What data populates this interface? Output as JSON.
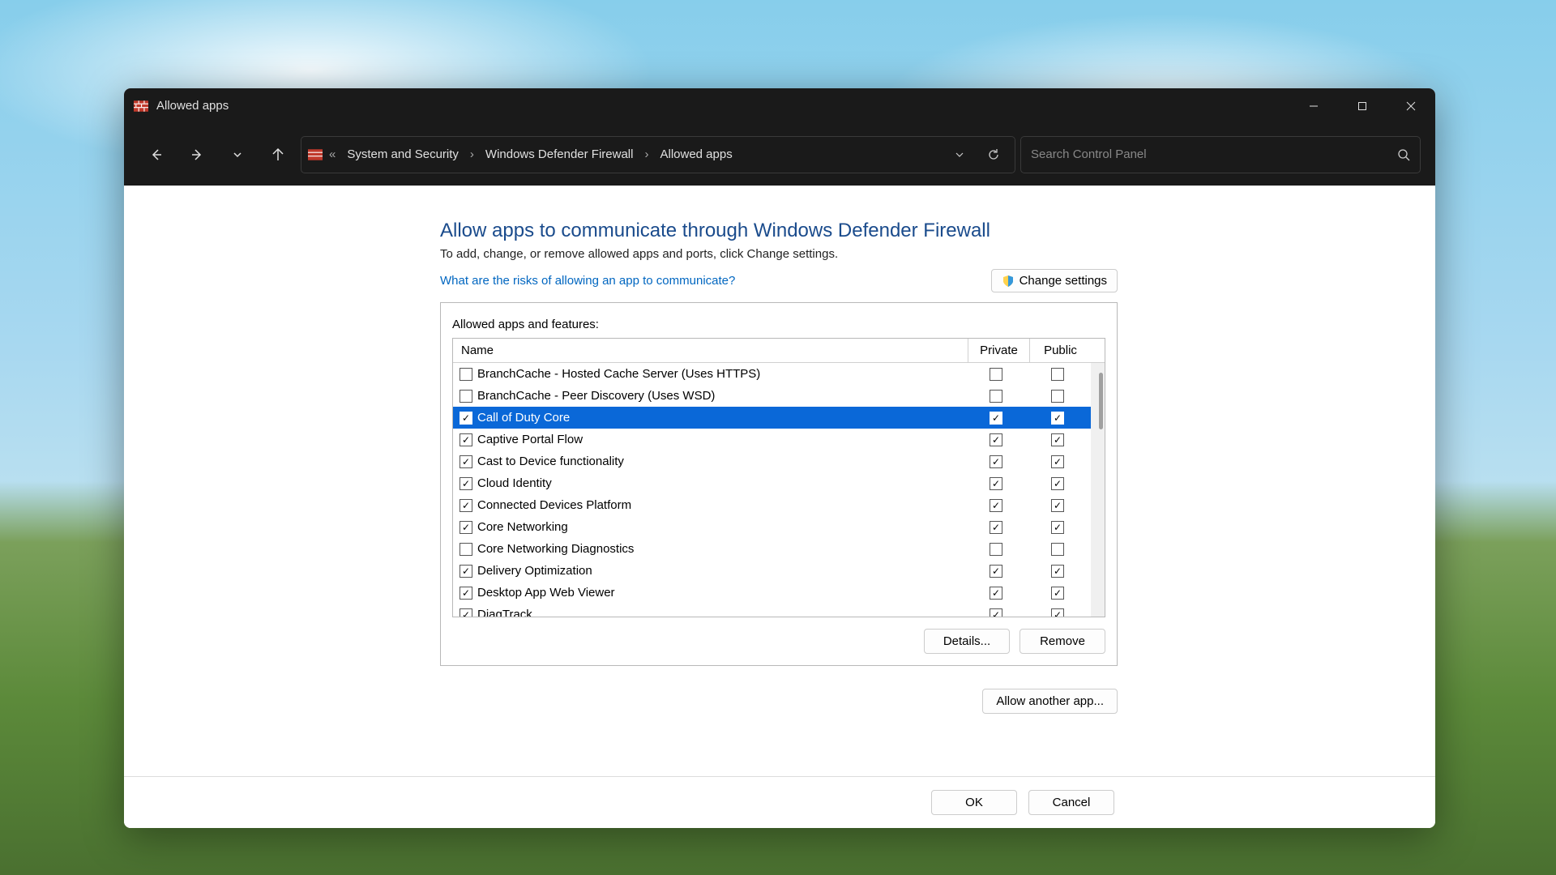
{
  "window": {
    "title": "Allowed apps"
  },
  "breadcrumb": {
    "items": [
      "System and Security",
      "Windows Defender Firewall",
      "Allowed apps"
    ]
  },
  "search": {
    "placeholder": "Search Control Panel"
  },
  "page": {
    "title": "Allow apps to communicate through Windows Defender Firewall",
    "subtitle": "To add, change, or remove allowed apps and ports, click Change settings.",
    "risks_link": "What are the risks of allowing an app to communicate?",
    "change_settings": "Change settings",
    "list_label": "Allowed apps and features:",
    "col_name": "Name",
    "col_private": "Private",
    "col_public": "Public",
    "details": "Details...",
    "remove": "Remove",
    "allow_another": "Allow another app...",
    "ok": "OK",
    "cancel": "Cancel"
  },
  "apps": [
    {
      "name": "BranchCache - Hosted Cache Server (Uses HTTPS)",
      "enabled": false,
      "private": false,
      "public": false,
      "selected": false
    },
    {
      "name": "BranchCache - Peer Discovery (Uses WSD)",
      "enabled": false,
      "private": false,
      "public": false,
      "selected": false
    },
    {
      "name": "Call of Duty Core",
      "enabled": true,
      "private": true,
      "public": true,
      "selected": true
    },
    {
      "name": "Captive Portal Flow",
      "enabled": true,
      "private": true,
      "public": true,
      "selected": false
    },
    {
      "name": "Cast to Device functionality",
      "enabled": true,
      "private": true,
      "public": true,
      "selected": false
    },
    {
      "name": "Cloud Identity",
      "enabled": true,
      "private": true,
      "public": true,
      "selected": false
    },
    {
      "name": "Connected Devices Platform",
      "enabled": true,
      "private": true,
      "public": true,
      "selected": false
    },
    {
      "name": "Core Networking",
      "enabled": true,
      "private": true,
      "public": true,
      "selected": false
    },
    {
      "name": "Core Networking Diagnostics",
      "enabled": false,
      "private": false,
      "public": false,
      "selected": false
    },
    {
      "name": "Delivery Optimization",
      "enabled": true,
      "private": true,
      "public": true,
      "selected": false
    },
    {
      "name": "Desktop App Web Viewer",
      "enabled": true,
      "private": true,
      "public": true,
      "selected": false
    },
    {
      "name": "DiagTrack",
      "enabled": true,
      "private": true,
      "public": true,
      "selected": false
    }
  ]
}
